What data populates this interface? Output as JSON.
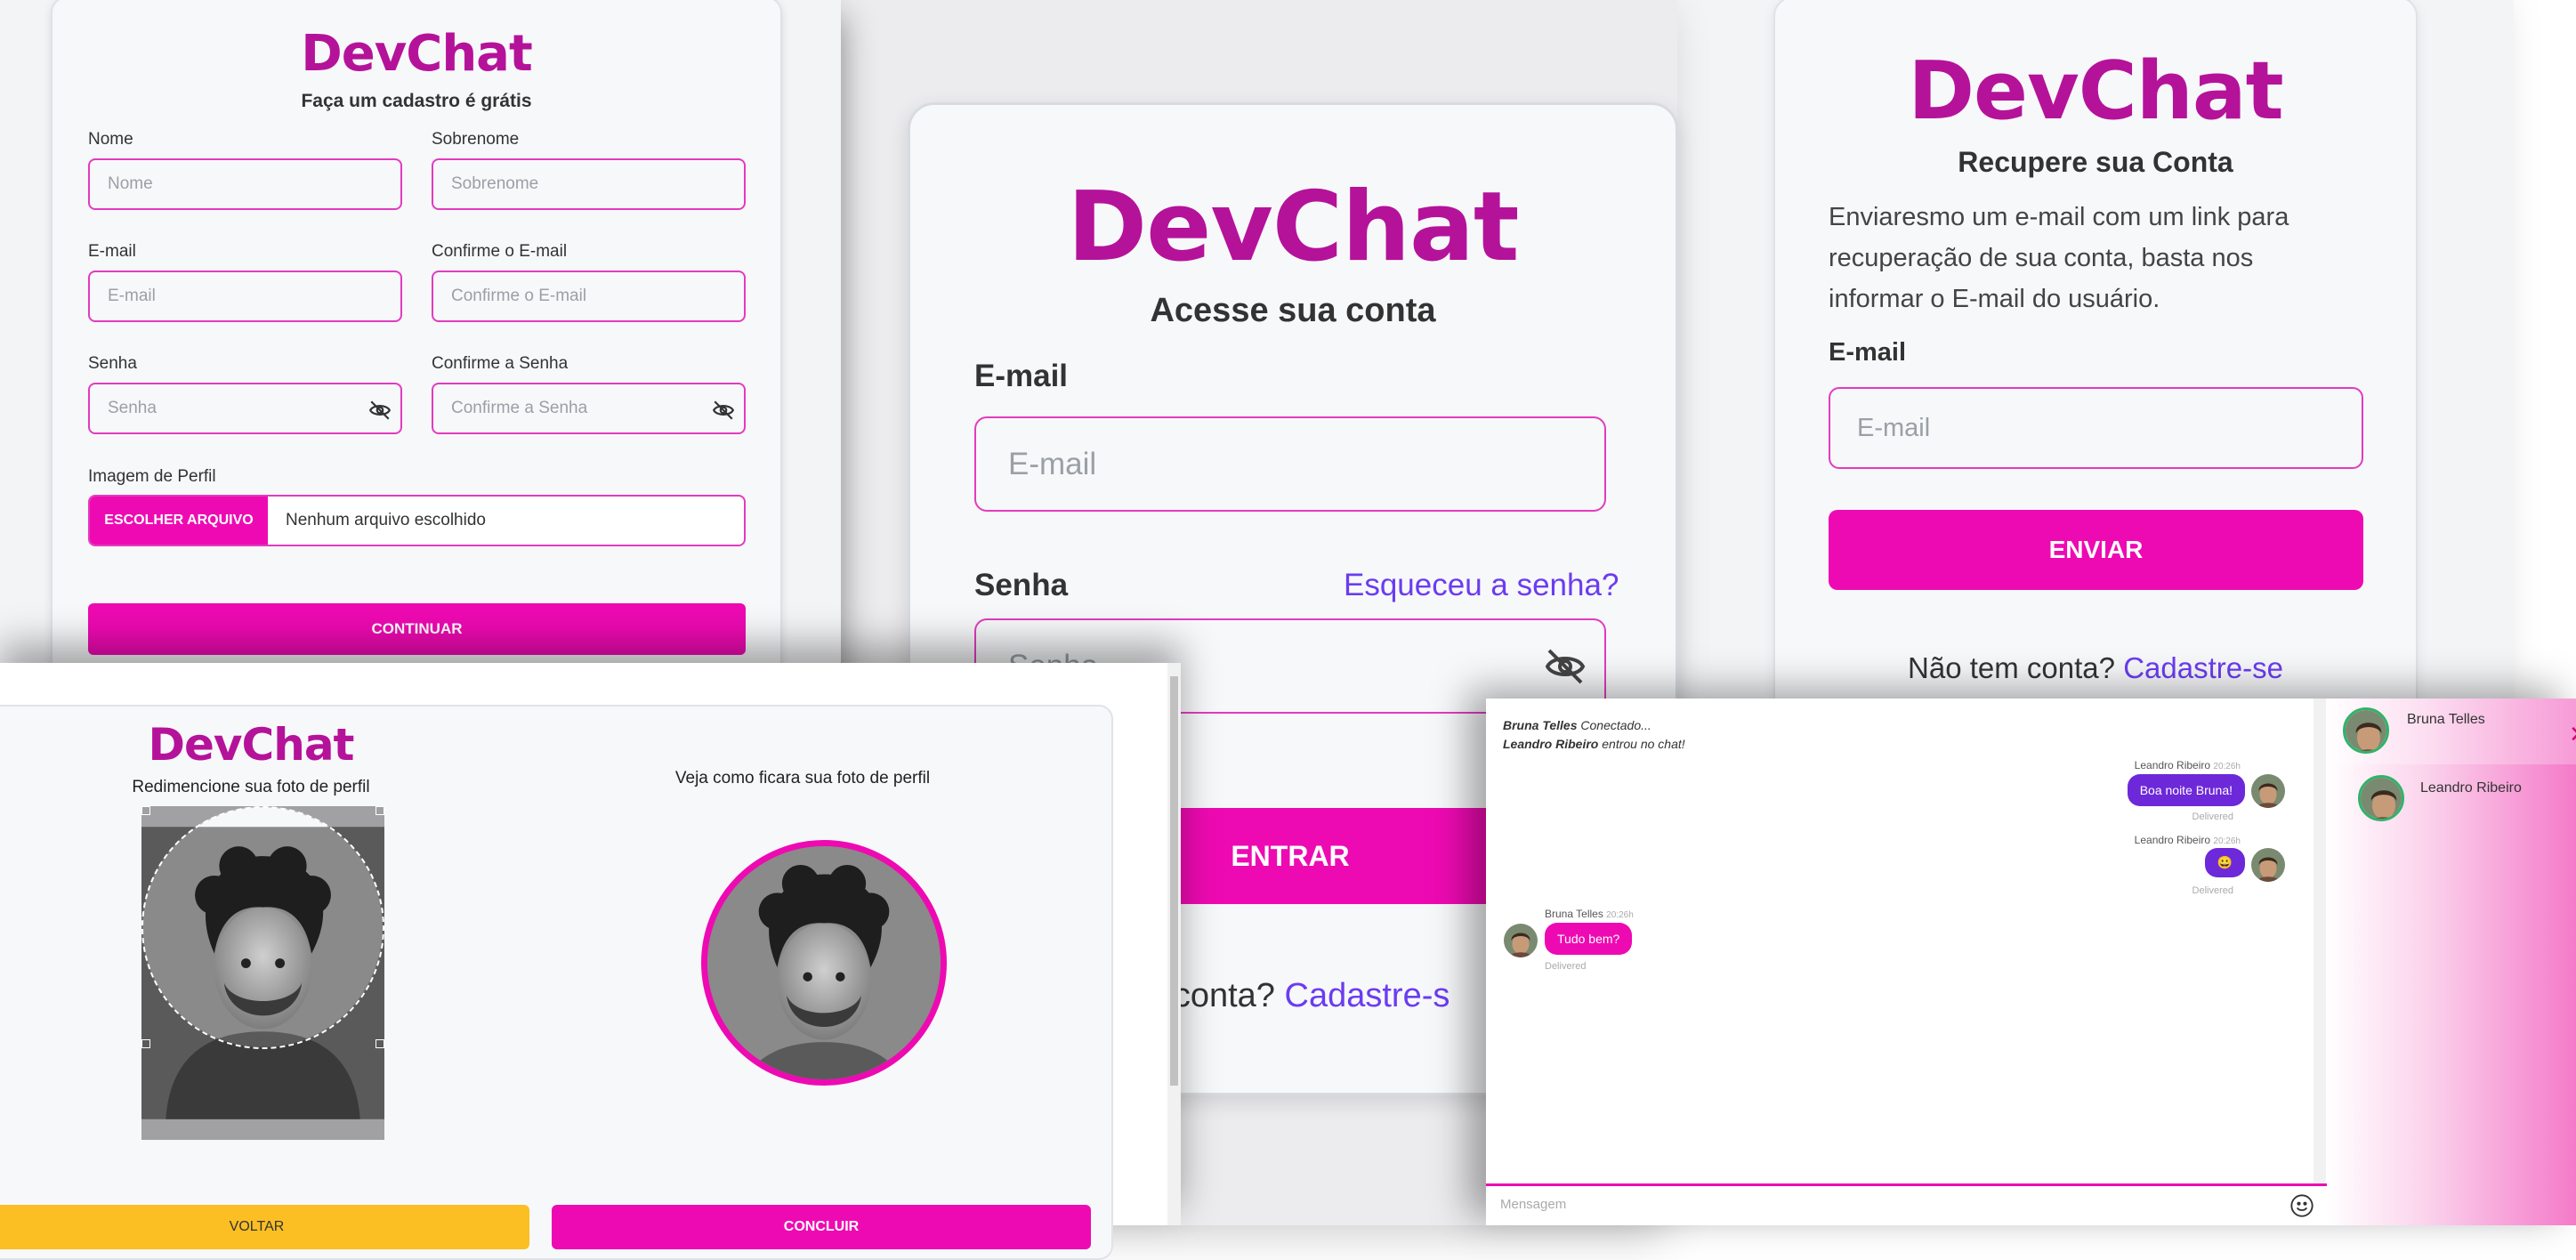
{
  "brand": "DevChat",
  "colors": {
    "accent": "#ee0ab2",
    "brand": "#b5129a",
    "link": "#6b3cf0",
    "warning": "#fbbf24",
    "purple": "#6d28d9"
  },
  "register": {
    "subtitle": "Faça um cadastro é grátis",
    "first_name_label": "Nome",
    "first_name_placeholder": "Nome",
    "last_name_label": "Sobrenome",
    "last_name_placeholder": "Sobrenome",
    "email_label": "E-mail",
    "email_placeholder": "E-mail",
    "confirm_email_label": "Confirme o E-mail",
    "confirm_email_placeholder": "Confirme o E-mail",
    "password_label": "Senha",
    "password_placeholder": "Senha",
    "confirm_password_label": "Confirme a Senha",
    "confirm_password_placeholder": "Confirme a Senha",
    "image_label": "Imagem de Perfil",
    "file_button": "ESCOLHER ARQUIVO",
    "file_status": "Nenhum arquivo escolhido",
    "submit": "CONTINUAR"
  },
  "login": {
    "subtitle": "Acesse sua conta",
    "email_label": "E-mail",
    "email_placeholder": "E-mail",
    "password_label": "Senha",
    "password_placeholder": "Senha",
    "forgot": "Esqueceu a senha?",
    "submit": "ENTRAR",
    "no_account_visible": "m conta?",
    "signup_visible": "Cadastre-s"
  },
  "recover": {
    "subtitle": "Recupere sua Conta",
    "desc_line1": "Enviaresmo um e-mail com um link para",
    "desc_line2": "recuperação de sua conta, basta nos",
    "desc_line3": "informar o E-mail do usuário.",
    "email_label": "E-mail",
    "email_placeholder": "E-mail",
    "submit": "ENVIAR",
    "no_account": "Não tem conta?",
    "signup": "Cadastre-se"
  },
  "crop": {
    "left_title": "Redimencione sua foto de perfil",
    "right_title": "Veja como ficara sua foto de perfil",
    "back": "VOLTAR",
    "finish": "CONCLUIR"
  },
  "chat": {
    "system": [
      {
        "name": "Bruna Telles",
        "text": "Conectado..."
      },
      {
        "name": "Leandro Ribeiro",
        "text": "entrou no chat!"
      }
    ],
    "messages": [
      {
        "sender": "Leandro Ribeiro",
        "time": "20:26h",
        "text": "Boa noite Bruna!",
        "status": "Delivered"
      },
      {
        "sender": "Leandro Ribeiro",
        "time": "20:26h",
        "text": "😀",
        "status": "Delivered"
      },
      {
        "sender": "Bruna Telles",
        "time": "20:26h",
        "text": "Tudo bem?",
        "status": "Delivered"
      }
    ],
    "input_placeholder": "Mensagem",
    "users": [
      "Bruna Telles",
      "Leandro Ribeiro"
    ],
    "close_icon": "close-icon",
    "emoji_icon": "smiley-icon"
  }
}
